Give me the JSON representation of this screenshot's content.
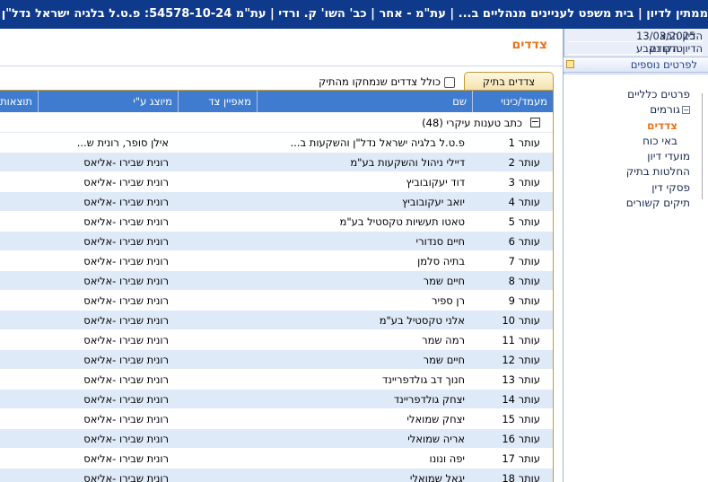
{
  "window": {
    "title": "ממתין לדיון | בית משפט לעניינים מנהליים ב... | עת\"מ - אחר | כב' השו' ק. ורדי | עת\"מ 54578-10-24: פ.ט.ל בלגיה ישראל נדל\"ן והשק..."
  },
  "side_panel": {
    "next_hearing_label": "הדיון הבא",
    "next_hearing_value": "13/03/2025",
    "prev_hearing_label": "הדיון הקודם",
    "prev_hearing_value": "טרם נקבע",
    "more_details_label": "לפרטים נוספים",
    "tree": [
      {
        "label": "פרטים כלליים",
        "level": 0,
        "active": false,
        "toggle": ""
      },
      {
        "label": "גורמים",
        "level": 0,
        "active": false,
        "toggle": "−"
      },
      {
        "label": "צדדים",
        "level": 1,
        "active": true,
        "toggle": ""
      },
      {
        "label": "באי כוח",
        "level": 1,
        "active": false,
        "toggle": ""
      },
      {
        "label": "מועדי דיון",
        "level": 0,
        "active": false,
        "toggle": ""
      },
      {
        "label": "החלטות בתיק",
        "level": 0,
        "active": false,
        "toggle": ""
      },
      {
        "label": "פסקי דין",
        "level": 0,
        "active": false,
        "toggle": ""
      },
      {
        "label": "תיקים קשורים",
        "level": 0,
        "active": false,
        "toggle": ""
      }
    ]
  },
  "main": {
    "page_title": "צדדים",
    "tab_label": "צדדים בתיק",
    "include_deleted_label": "כולל צדדים שנמחקו מהתיק",
    "columns": [
      "מעמד/כינוי",
      "שם",
      "מאפיין צד",
      "מיוצג ע\"י",
      "תוצאות פסק"
    ],
    "group_label": "כתב טענות עיקרי (48)",
    "rows": [
      {
        "role": "עותר 1",
        "name": "פ.ט.ל בלגיה ישראל נדל\"ן והשקעות ב...",
        "spec": "",
        "rep": "אילן סופר, רונית ש..."
      },
      {
        "role": "עותר 2",
        "name": "דיילי ניהול והשקעות בע\"מ",
        "spec": "",
        "rep": "רונית שבירו -אליאס"
      },
      {
        "role": "עותר 3",
        "name": "דוד יעקובוביץ",
        "spec": "",
        "rep": "רונית שבירו -אליאס"
      },
      {
        "role": "עותר 4",
        "name": "יואב יעקובוביץ",
        "spec": "",
        "rep": "רונית שבירו -אליאס"
      },
      {
        "role": "עותר 5",
        "name": "טאטו תעשיות טקסטיל בע\"מ",
        "spec": "",
        "rep": "רונית שבירו -אליאס"
      },
      {
        "role": "עותר 6",
        "name": "חיים סנדורי",
        "spec": "",
        "rep": "רונית שבירו -אליאס"
      },
      {
        "role": "עותר 7",
        "name": "בתיה סלמן",
        "spec": "",
        "rep": "רונית שבירו -אליאס"
      },
      {
        "role": "עותר 8",
        "name": "חיים שמר",
        "spec": "",
        "rep": "רונית שבירו -אליאס"
      },
      {
        "role": "עותר 9",
        "name": "רן ספיר",
        "spec": "",
        "rep": "רונית שבירו -אליאס"
      },
      {
        "role": "עותר 10",
        "name": "אלני טקסטיל בע\"מ",
        "spec": "",
        "rep": "רונית שבירו -אליאס"
      },
      {
        "role": "עותר 11",
        "name": "רמה שמר",
        "spec": "",
        "rep": "רונית שבירו -אליאס"
      },
      {
        "role": "עותר 12",
        "name": "חיים שמר",
        "spec": "",
        "rep": "רונית שבירו -אליאס"
      },
      {
        "role": "עותר 13",
        "name": "חנוך דב גולדפריינד",
        "spec": "",
        "rep": "רונית שבירו -אליאס"
      },
      {
        "role": "עותר 14",
        "name": "יצחק גולדפריינד",
        "spec": "",
        "rep": "רונית שבירו -אליאס"
      },
      {
        "role": "עותר 15",
        "name": "יצחק שמואלי",
        "spec": "",
        "rep": "רונית שבירו -אליאס"
      },
      {
        "role": "עותר 16",
        "name": "אריה שמואלי",
        "spec": "",
        "rep": "רונית שבירו -אליאס"
      },
      {
        "role": "עותר 17",
        "name": "יפה ונונו",
        "spec": "",
        "rep": "רונית שבירו -אליאס"
      },
      {
        "role": "עותר 18",
        "name": "יגאל שמואלי",
        "spec": "",
        "rep": "רונית שבירו -אליאס"
      }
    ]
  }
}
